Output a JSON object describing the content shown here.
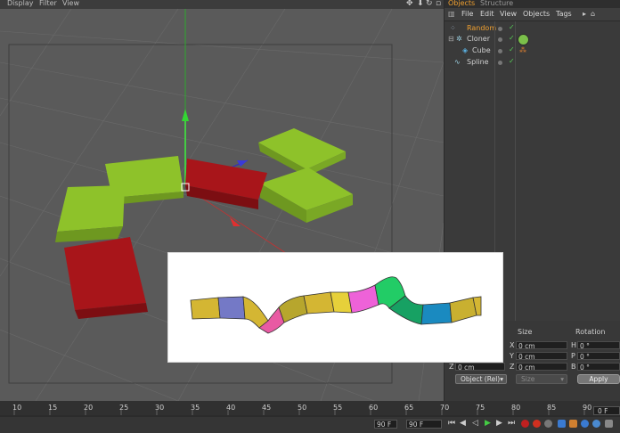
{
  "viewport_menu": {
    "items": [
      "Display",
      "Filter",
      "View"
    ]
  },
  "viewport_icons": [
    "move-icon",
    "down-arrow-icon",
    "rotate-icon",
    "square-icon"
  ],
  "objects_panel": {
    "tabs": [
      "Objects",
      "Structure"
    ],
    "menu": [
      "File",
      "Edit",
      "View",
      "Objects",
      "Tags"
    ],
    "tree": [
      {
        "label": "Random",
        "color": "#f0a030"
      },
      {
        "label": "Cloner",
        "color": "#d0d0d0"
      },
      {
        "label": "Cube",
        "color": "#d0d0d0"
      },
      {
        "label": "Spline",
        "color": "#d0d0d0"
      }
    ]
  },
  "coords": {
    "headers": [
      "Size",
      "Rotation"
    ],
    "axes_pos": [
      "X",
      "Y",
      "Z"
    ],
    "rows": [
      {
        "pos": "",
        "size": "0 cm",
        "rot_axis": "H",
        "rot": "0 °"
      },
      {
        "pos": "",
        "size": "0 cm",
        "rot_axis": "P",
        "rot": "0 °"
      },
      {
        "pos_axis": "Z",
        "pos": "0 cm",
        "size": "0 cm",
        "rot_axis": "B",
        "rot": "0 °"
      }
    ],
    "mode_dropdown": "Object (Rel)",
    "size_dropdown": "Size",
    "apply": "Apply"
  },
  "timeline": {
    "ticks": [
      "10",
      "15",
      "20",
      "25",
      "30",
      "35",
      "40",
      "45",
      "50",
      "55",
      "60",
      "65",
      "70",
      "75",
      "80",
      "85",
      "90"
    ],
    "current_frame": "0 F",
    "end_frame_a": "90 F",
    "end_frame_b": "90 F"
  },
  "colors": {
    "green_block": "#8ec22a",
    "red_block": "#a8151a",
    "accent_orange": "#f0a030"
  }
}
